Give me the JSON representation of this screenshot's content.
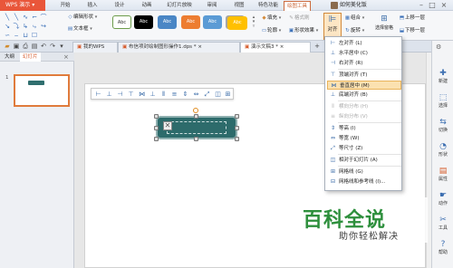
{
  "app": {
    "name": "WPS 演示"
  },
  "menu_tabs": [
    "开始",
    "插入",
    "设计",
    "动画",
    "幻灯片放映",
    "审阅",
    "视图",
    "特色功能",
    "绘图工具"
  ],
  "user": {
    "name": "如何美化饭"
  },
  "ribbon": {
    "edit_shape": "编辑形状",
    "text_box": "文本框",
    "style_swatch_label": "Abc",
    "fill": "填充",
    "format_painter": "格式刷",
    "outline": "轮廓",
    "shape_effect": "形状效果",
    "align": "对齐",
    "rotate": "旋转",
    "group": "组合",
    "selection_pane": "选择窗格",
    "up_one": "上移一层",
    "down_one": "下移一层"
  },
  "swatch_colors": [
    "#ffffff",
    "#000000",
    "#4a86c5",
    "#ed7d31",
    "#5b9bd5",
    "#a5a5a5",
    "#ffc000"
  ],
  "tabs": [
    {
      "label": "我的WPS"
    },
    {
      "label": "布信项封绘制图形操作1.dps *"
    },
    {
      "label": "演示文稿3 *"
    }
  ],
  "left_panel": {
    "tab_outline": "大纲",
    "tab_slides": "幻灯片",
    "slide_number": "1"
  },
  "align_menu": {
    "items": [
      {
        "label": "左对齐 (L)",
        "icon": "align-left-icon",
        "enabled": true
      },
      {
        "label": "水平居中 (C)",
        "icon": "align-center-icon",
        "enabled": true
      },
      {
        "label": "右对齐 (R)",
        "icon": "align-right-icon",
        "enabled": true
      },
      {
        "label": "顶端对齐 (T)",
        "icon": "align-top-icon",
        "enabled": true
      },
      {
        "label": "垂直居中 (M)",
        "icon": "align-middle-icon",
        "enabled": true,
        "highlighted": true
      },
      {
        "label": "底端对齐 (B)",
        "icon": "align-bottom-icon",
        "enabled": true
      },
      {
        "label": "横向分布 (H)",
        "icon": "distribute-h-icon",
        "enabled": false
      },
      {
        "label": "纵向分布 (V)",
        "icon": "distribute-v-icon",
        "enabled": false
      },
      {
        "label": "等高 (I)",
        "icon": "same-height-icon",
        "enabled": true
      },
      {
        "label": "等宽 (W)",
        "icon": "same-width-icon",
        "enabled": true
      },
      {
        "label": "等尺寸 (Z)",
        "icon": "same-size-icon",
        "enabled": true
      },
      {
        "label": "相对于幻灯片 (A)",
        "icon": "relative-slide-icon",
        "enabled": true
      },
      {
        "label": "网格线 (G)",
        "icon": "gridlines-icon",
        "enabled": true
      },
      {
        "label": "网格线和参考线 (I)...",
        "icon": "grid-guides-icon",
        "enabled": true
      }
    ]
  },
  "right_bar": [
    "新建",
    "选择",
    "切换",
    "形状",
    "属性",
    "动作",
    "工具",
    "帮助"
  ],
  "watermark": {
    "title": "百科全说",
    "subtitle": "助你轻松解决"
  }
}
